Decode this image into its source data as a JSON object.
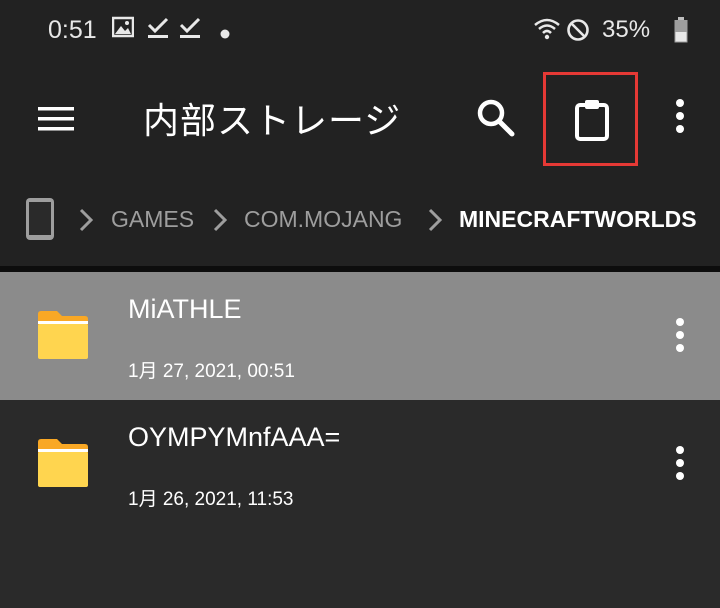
{
  "status_bar": {
    "time": "0:51",
    "battery": "35%",
    "icons": [
      "image-icon",
      "download-done-icon",
      "download-done-icon",
      "notification-dot-icon",
      "wifi-icon",
      "do-not-disturb-icon",
      "battery-icon"
    ]
  },
  "toolbar": {
    "title": "内部ストレージ",
    "icons": [
      "menu-icon",
      "search-icon",
      "clipboard-icon",
      "more-vert-icon"
    ]
  },
  "breadcrumb": {
    "items": [
      "GAMES",
      "COM.MOJANG",
      "MINECRAFTWORLDS"
    ],
    "root_icon": "phone-icon"
  },
  "files": [
    {
      "name": "MiATHLE",
      "date": "1月 27, 2021, 00:51",
      "selected": true,
      "icon": "folder-icon"
    },
    {
      "name": "OYMPYMnfAAA=",
      "date": "1月 26, 2021, 11:53",
      "selected": false,
      "icon": "folder-icon"
    }
  ],
  "colors": {
    "background": "#2a2a2a",
    "toolbar": "#222222",
    "selected_row": "#8b8b8b",
    "folder": "#f9a825",
    "highlight_border": "#e53935"
  }
}
